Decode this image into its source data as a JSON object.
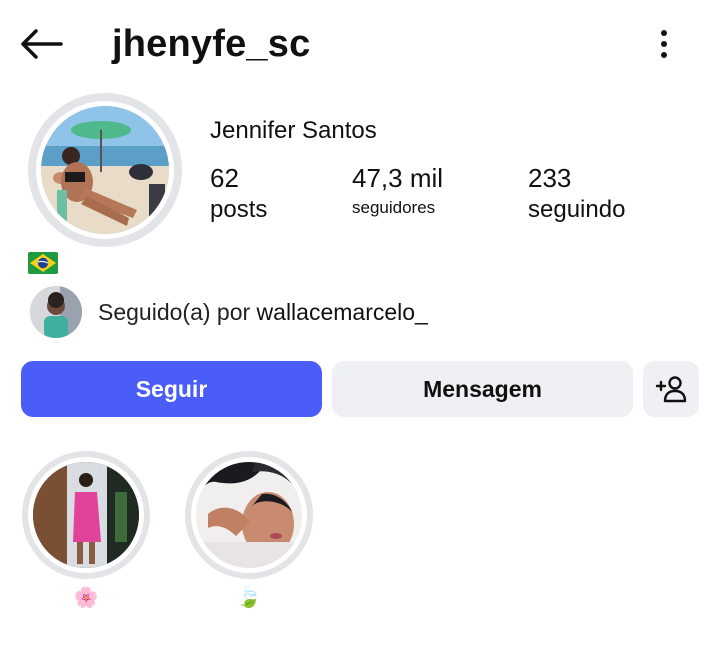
{
  "header": {
    "username": "jhenyfe_sc",
    "back_icon": "arrow-left-icon",
    "more_icon": "more-vertical-icon"
  },
  "profile": {
    "display_name": "Jennifer Santos",
    "flag_emoji": "🇧🇷",
    "stats": {
      "posts": {
        "value": "62",
        "label": "posts"
      },
      "followers": {
        "value": "47,3 mil",
        "label": "seguidores"
      },
      "following": {
        "value": "233",
        "label": "seguindo"
      }
    }
  },
  "followed_by": {
    "prefix": "Seguido(a) por ",
    "user": "wallacemarcelo_"
  },
  "actions": {
    "follow_label": "Seguir",
    "message_label": "Mensagem",
    "suggest_icon": "add-person-icon"
  },
  "highlights": [
    {
      "label": "🌸"
    },
    {
      "label": "🍃"
    }
  ],
  "colors": {
    "follow_button": "#4a5df9",
    "secondary_button": "#eff0f3",
    "ring": "#e3e4e8"
  }
}
